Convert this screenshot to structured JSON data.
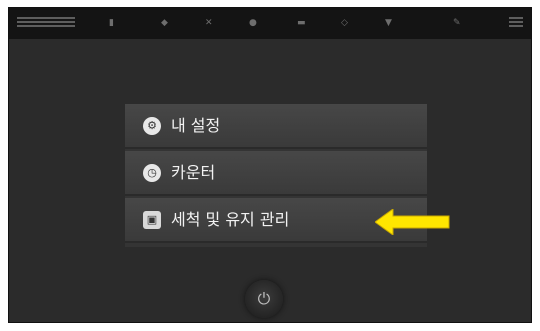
{
  "menu": {
    "items": [
      {
        "label": "내 설정",
        "icon": "gear-icon"
      },
      {
        "label": "카운터",
        "icon": "clock-icon"
      },
      {
        "label": "세척 및 유지 관리",
        "icon": "cleaning-icon"
      }
    ]
  },
  "power": {
    "icon": "power-icon",
    "glyph": "⏻"
  },
  "colors": {
    "arrow": "#ffe600",
    "background": "#2b2b2b",
    "menu": "#404040"
  }
}
